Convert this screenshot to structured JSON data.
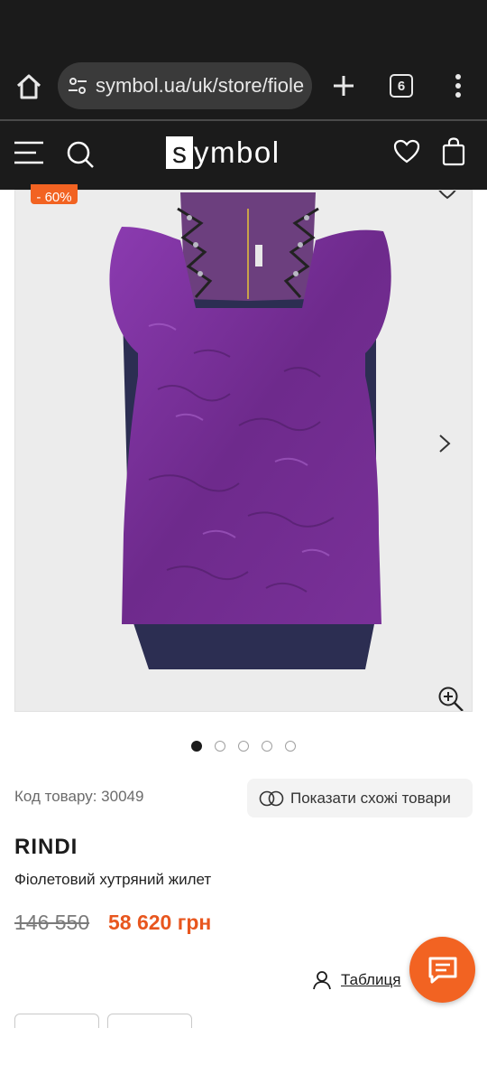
{
  "browser": {
    "url": "symbol.ua/uk/store/fiole",
    "tab_count": "6",
    "icons": [
      "home-icon",
      "site-settings-icon",
      "new-tab-icon",
      "tabs-icon",
      "overflow-menu-icon"
    ]
  },
  "site_header": {
    "logo_letter": "s",
    "logo_rest": "ymbol",
    "icons": [
      "menu-icon",
      "search-icon",
      "heart-icon",
      "bag-icon"
    ]
  },
  "gallery": {
    "discount_badge": "- 60%",
    "image_count": 5,
    "active_index": 0,
    "icons": [
      "wishlist-icon",
      "next-arrow-icon",
      "zoom-in-icon"
    ]
  },
  "product": {
    "sku_label": "Код товару: 30049",
    "similar_button": "Показати схожі товари",
    "brand": "RINDI",
    "name": "Фіолетовий хутряний жилет",
    "old_price": "146 550",
    "new_price": "58 620 грн",
    "size_table_link": "Таблиця"
  },
  "colors": {
    "header_bg": "#1b1b1b",
    "accent": "#f26322",
    "price_sale": "#e8561e",
    "vest_purple": "#7a2f9a"
  }
}
